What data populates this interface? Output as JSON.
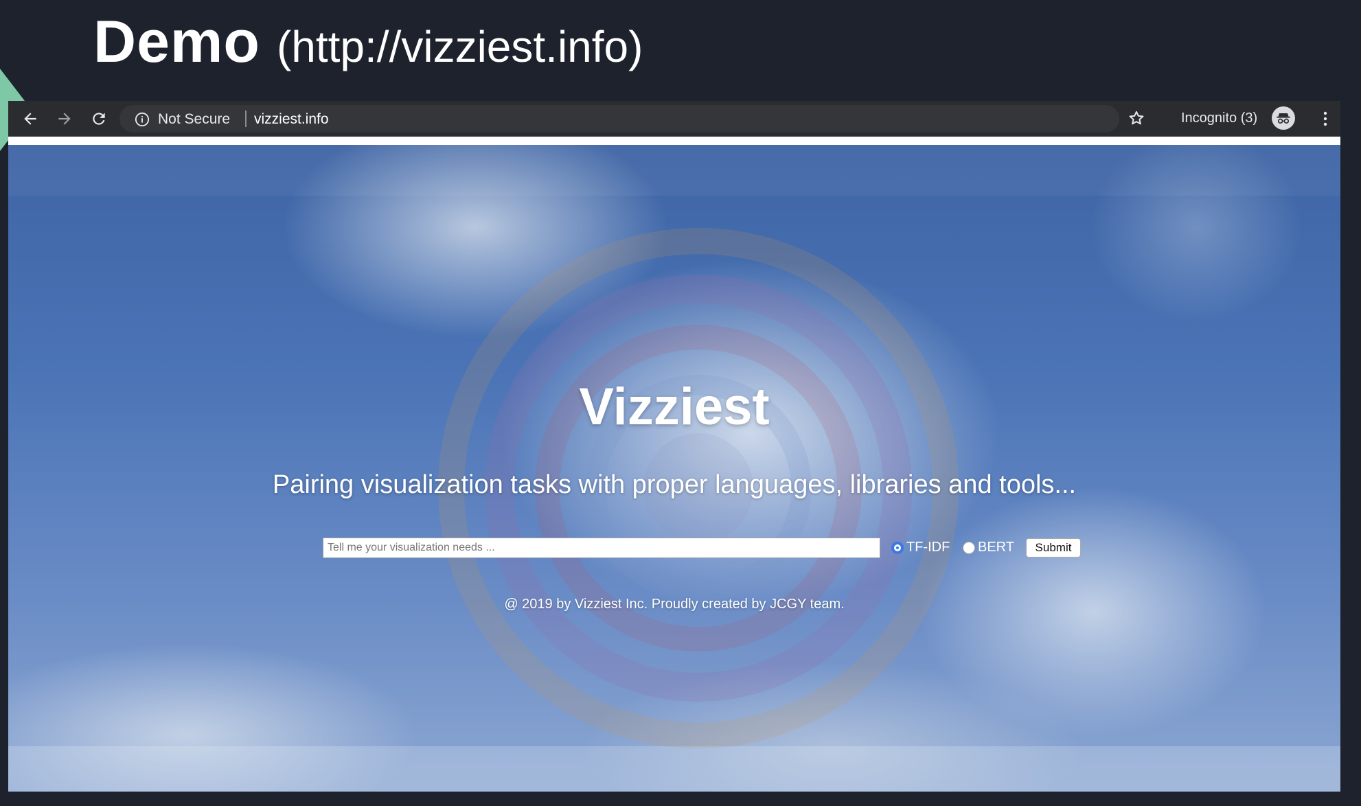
{
  "slide": {
    "title_strong": "Demo",
    "title_url": "(http://vizziest.info)"
  },
  "browser": {
    "security_label": "Not Secure",
    "url": "vizziest.info",
    "incognito_label": "Incognito (3)"
  },
  "page": {
    "title": "Vizziest",
    "tagline": "Pairing visualization tasks with proper languages, libraries and tools...",
    "search": {
      "placeholder": "Tell me your visualization needs ...",
      "value": ""
    },
    "options": [
      {
        "label": "TF-IDF",
        "selected": true
      },
      {
        "label": "BERT",
        "selected": false
      }
    ],
    "submit_label": "Submit",
    "footer": "@ 2019 by Vizziest Inc. Proudly created by JCGY team."
  },
  "icons": {
    "back": "arrow-left-icon",
    "forward": "arrow-right-icon",
    "reload": "reload-icon",
    "info": "info-icon",
    "bookmark": "star-icon",
    "incognito": "incognito-icon",
    "menu": "vertical-dots-icon"
  },
  "colors": {
    "slide_background": "#1e222d",
    "accent_triangle": "#7ec8a7",
    "radio_selected": "#3b78e7"
  }
}
